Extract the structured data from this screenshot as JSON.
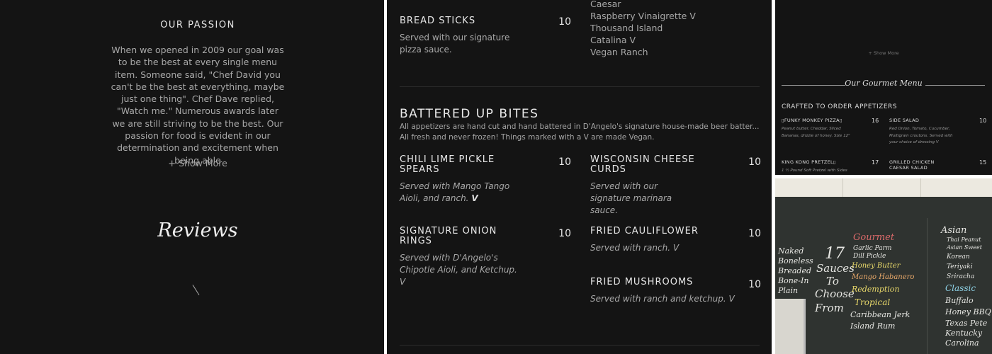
{
  "about": {
    "title": "OUR PASSION",
    "text": "When we opened in 2009 our goal was to be the best at every single menu item. Someone said, \"Chef David you can't be the best at everything, maybe just one thing\". Chef Dave replied, \"Watch me.\" Numerous awards later we are still striving to be the best.  Our passion for food is evident in our determination and excitement when being able",
    "show_more": "Show More",
    "show_more_icon": "plus-icon",
    "reviews_title": "Reviews"
  },
  "menu": {
    "dressings": [
      "Caesar",
      "Raspberry Vinaigrette V",
      "Thousand Island",
      "Catalina V",
      "Vegan Ranch"
    ],
    "bread_sticks": {
      "name": "BREAD STICKS",
      "price": "10",
      "desc": "Served with our signature pizza sauce."
    },
    "section": {
      "title": "BATTERED UP BITES",
      "desc": "All appetizers are hand cut and hand battered in D'Angelo's signature house-made beer batter... All fresh and never frozen! Things marked with a V are made Vegan."
    },
    "items": [
      {
        "name": "CHILI LIME PICKLE SPEARS",
        "price": "10",
        "desc": "Served with Mango Tango Aioli, and ranch.",
        "badge": "V"
      },
      {
        "name": "WISCONSIN CHEESE CURDS",
        "price": "10",
        "desc": "Served with our signature marinara sauce."
      },
      {
        "name": "SIGNATURE ONION RINGS",
        "price": "10",
        "desc": "Served with D'Angelo's Chipotle Aioli, and Ketchup. V"
      },
      {
        "name": "FRIED CAULIFLOWER",
        "price": "10",
        "desc": "Served with ranch. V"
      },
      {
        "name": "FRIED MUSHROOMS",
        "price": "10",
        "desc": " Served with ranch and ketchup. V"
      }
    ]
  },
  "preview": {
    "show_more": "+ Show More",
    "gourmet_title": "Our Gourmet Menu",
    "crafted_title": "CRAFTED TO ORDER APPETIZERS",
    "items": [
      {
        "name": "▯FUNKY MONKEY PIZZA▯",
        "price": "16",
        "desc": "Peanut butter, Cheddar, Sliced Bananas, drizzle of honey. Size 12\""
      },
      {
        "name": "SIDE SALAD",
        "price": "10",
        "desc": "Red Onion, Tomato, Cucumber, Multigrain croutons. Served with your choice of dressing V"
      },
      {
        "name": "KING KONG PRETZEL▯",
        "price": "17",
        "desc": "1 ½ Pound Soft Pretzel with Sides"
      },
      {
        "name": "GRILLED CHICKEN CAESAR SALAD",
        "price": "15",
        "desc": ""
      }
    ]
  },
  "photo": {
    "chalk_lines": [
      "Gourmet",
      "Garlic Parm",
      "Dill Pickle",
      "Honey Butter",
      "Mango Habanero",
      "Redemption",
      "Tropical",
      "Caribbean Jerk",
      "Island Rum",
      "17",
      "Sauces",
      "To",
      "Choose",
      "From",
      "Asian",
      "Thai Peanut",
      "Asian Sweet",
      "Korean",
      "Teriyaki",
      "Sriracha",
      "Classic",
      "Buffalo",
      "Honey BBQ",
      "Texas Pete",
      "Kentucky",
      "Carolina",
      "Naked",
      "Boneless",
      "Breaded",
      "Bone-In",
      "Plain"
    ],
    "colors": {
      "board": "#2f3330",
      "red": "#d96a6a",
      "yellow": "#e8d86a",
      "white": "#e6e6e2",
      "blue": "#8fd4e8"
    }
  }
}
